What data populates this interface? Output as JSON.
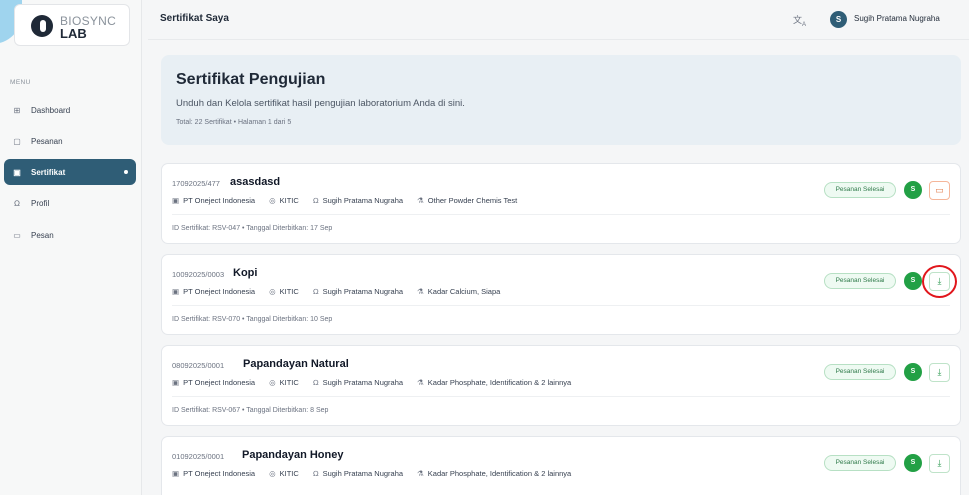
{
  "brand": {
    "line1": "BIOSYNC",
    "line2": "LAB"
  },
  "sidebar": {
    "menu_label": "MENU",
    "items": [
      {
        "label": "Dashboard",
        "icon": "grid-icon",
        "glyph": "⊞"
      },
      {
        "label": "Pesanan",
        "icon": "calendar-icon",
        "glyph": "▢"
      },
      {
        "label": "Sertifikat",
        "icon": "certificate-icon",
        "glyph": "▣",
        "active": true
      },
      {
        "label": "Profil",
        "icon": "user-icon",
        "glyph": "Ω"
      },
      {
        "label": "Pesan",
        "icon": "message-icon",
        "glyph": "▭"
      }
    ]
  },
  "header": {
    "title": "Sertifikat Saya",
    "translate_glyph": "ᵀ",
    "user": {
      "initial": "S",
      "name": "Sugih Pratama Nugraha"
    }
  },
  "hero": {
    "title": "Sertifikat Pengujian",
    "subtitle": "Unduh dan Kelola sertifikat hasil pengujian laboratorium Anda di sini.",
    "stats": "Total: 22 Sertifikat  •  Halaman 1 dari 5"
  },
  "certificates": [
    {
      "code": "17092025/477",
      "name": "asasdasd",
      "company": "PT Oneject Indonesia",
      "location": "KITIC",
      "person": "Sugih Pratama Nugraha",
      "test": "Other Powder Chemis Test",
      "footer": "ID Sertifikat: RSV-047  •  Tanggal Diterbitkan: 17 Sep",
      "status": "Pesanan Selesai",
      "avatar": "S",
      "action": "chat"
    },
    {
      "code": "10092025/0003",
      "name": "Kopi",
      "company": "PT Oneject Indonesia",
      "location": "KITIC",
      "person": "Sugih Pratama Nugraha",
      "test": "Kadar Calcium, Siapa",
      "footer": "ID Sertifikat: RSV-070  •  Tanggal Diterbitkan: 10 Sep",
      "status": "Pesanan Selesai",
      "avatar": "S",
      "action": "download",
      "highlighted": true
    },
    {
      "code": "08092025/0001",
      "name": "Papandayan Natural",
      "company": "PT Oneject Indonesia",
      "location": "KITIC",
      "person": "Sugih Pratama Nugraha",
      "test": "Kadar Phosphate, Identification & 2 lainnya",
      "footer": "ID Sertifikat: RSV-067  •  Tanggal Diterbitkan: 8 Sep",
      "status": "Pesanan Selesai",
      "avatar": "S",
      "action": "download"
    },
    {
      "code": "01092025/0001",
      "name": "Papandayan Honey",
      "company": "PT Oneject Indonesia",
      "location": "KITIC",
      "person": "Sugih Pratama Nugraha",
      "test": "Kadar Phosphate, Identification & 2 lainnya",
      "footer": "",
      "status": "Pesanan Selesai",
      "avatar": "S",
      "action": "download"
    }
  ],
  "icons": {
    "company": "▣",
    "location": "◎",
    "person": "Ω",
    "test": "⚗",
    "chat": "▭",
    "download": "⤓"
  },
  "colors": {
    "primary": "#2f5d76",
    "success": "#22a045",
    "highlight": "#e1161c"
  }
}
